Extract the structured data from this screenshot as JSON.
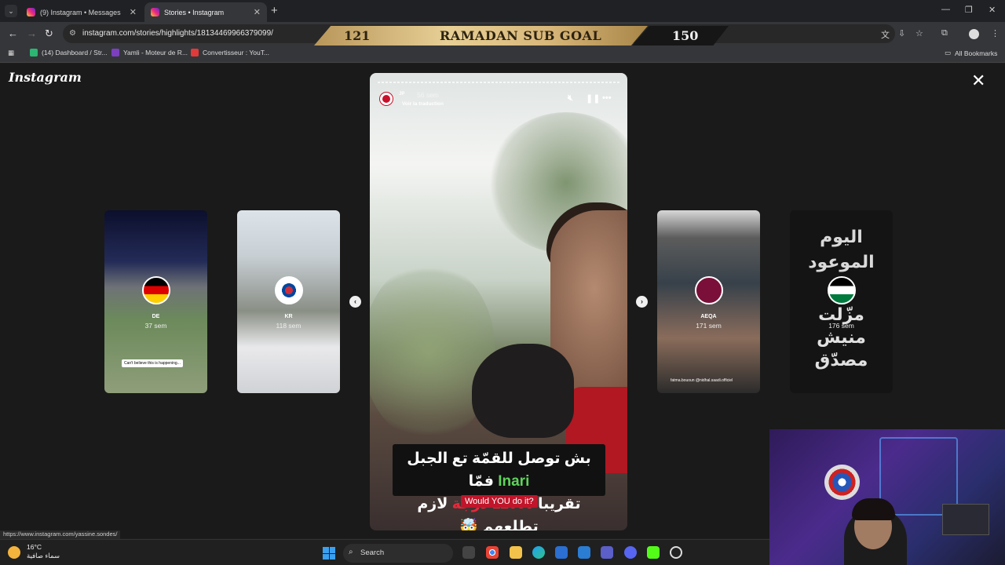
{
  "browser": {
    "tabs": [
      {
        "title": "(9) Instagram • Messages",
        "active": false
      },
      {
        "title": "Stories • Instagram",
        "active": true
      }
    ],
    "url": "instagram.com/stories/highlights/18134469966379099/",
    "bookmarks": [
      {
        "label": "(14) Dashboard / Str..."
      },
      {
        "label": "Yamli - Moteur de R..."
      },
      {
        "label": "Convertisseur : YouT..."
      }
    ],
    "all_bookmarks": "All Bookmarks",
    "status_url": "https://www.instagram.com/yassine.sondes/"
  },
  "overlay": {
    "current": "121",
    "title": "RAMADAN SUB GOAL",
    "goal": "150"
  },
  "instagram": {
    "logo": "Instagram",
    "side_stories": [
      {
        "user": "DE",
        "age": "37 sem",
        "caption": "Can't believe this is happening..."
      },
      {
        "user": "KR",
        "age": "118 sem",
        "caption": ""
      },
      {
        "user": "AEQA",
        "age": "171 sem",
        "caption": "fatma.bououn @nidhal.saadi.officiel"
      },
      {
        "user": "",
        "age": "176 sem",
        "caption": ""
      }
    ],
    "last_story_text": [
      "اليوم",
      "الموعود",
      "مزّلت",
      "منيش",
      "مصدّق"
    ],
    "main_story": {
      "user": "JP",
      "time": "56 sem",
      "translate": "Voir la traduction",
      "caption_line1_a": "بش توصل للقمّة تع الجبل ",
      "caption_line1_b": "Inari",
      "caption_line1_c": " فمّا",
      "caption_line2_a": "تقريبا ",
      "caption_line2_b": "12000 درجة",
      "caption_line2_c": " لازم تطلعهم 🤯",
      "question": "Would YOU do it?"
    }
  },
  "taskbar": {
    "temp": "16°C",
    "weather": "سماء صافية",
    "search": "Search"
  },
  "colors": {
    "accent_green": "#5fd35b",
    "accent_red": "#e6283b",
    "goal_gold": "#d8b77a"
  }
}
